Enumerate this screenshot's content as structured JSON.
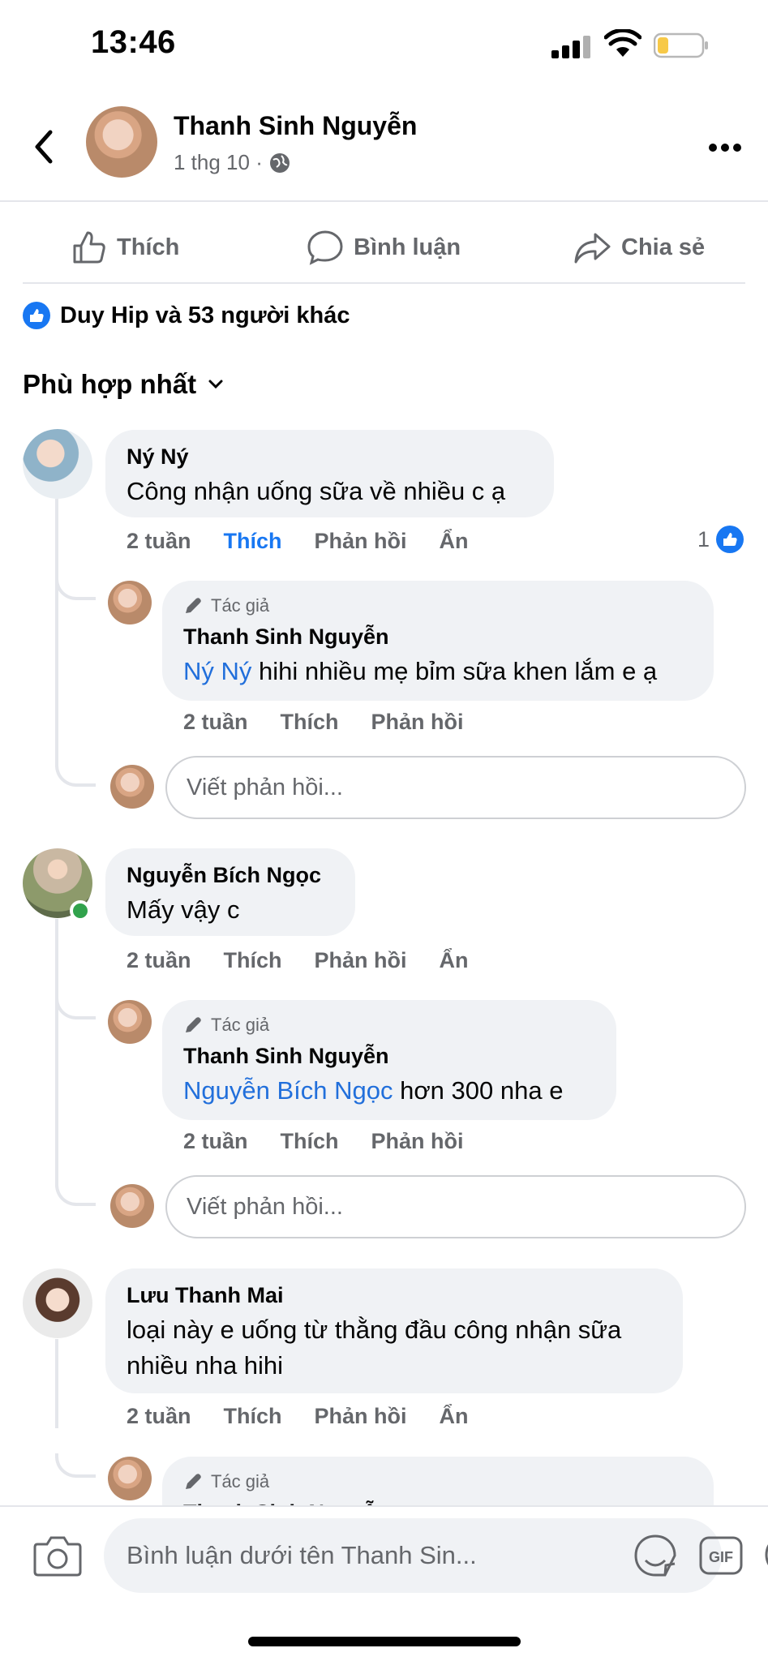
{
  "status_bar": {
    "time": "13:46",
    "battery_level": 0.25,
    "battery_color": "#f7c948"
  },
  "post": {
    "author": "Thanh Sinh Nguyễn",
    "date": "1 thg 10 ·",
    "privacy_icon": "globe-icon"
  },
  "actions": {
    "like": "Thích",
    "comment": "Bình luận",
    "share": "Chia sẻ"
  },
  "likes_summary": "Duy Hip và 53 người khác",
  "sort_label": "Phù hợp nhất",
  "author_badge": "Tác giả",
  "reply_placeholder": "Viết phản hồi...",
  "comments": [
    {
      "name": "Ný Ný",
      "text": "Công nhận uống sữa về nhiều c ạ",
      "time": "2 tuần",
      "like": "Thích",
      "reply": "Phản hồi",
      "hide": "Ẩn",
      "reactions": "1",
      "reply_item": {
        "name": "Thanh Sinh Nguyễn",
        "mention": "Ný Ný",
        "text": " hihi nhiều mẹ bỉm sữa khen lắm e ạ",
        "time": "2 tuần",
        "like": "Thích",
        "reply": "Phản hồi"
      }
    },
    {
      "name": "Nguyễn Bích Ngọc",
      "text": "Mấy vậy c",
      "time": "2 tuần",
      "like": "Thích",
      "reply": "Phản hồi",
      "hide": "Ẩn",
      "reply_item": {
        "name": "Thanh Sinh Nguyễn",
        "mention": "Nguyễn Bích Ngọc",
        "text": " hơn 300 nha e",
        "time": "2 tuần",
        "like": "Thích",
        "reply": "Phản hồi"
      }
    },
    {
      "name": "Lưu Thanh Mai",
      "text_line1": "loại này e uống từ thằng đầu công nhận sữa",
      "text_line2": "nhiều nha hihi",
      "time": "2 tuần",
      "like": "Thích",
      "reply": "Phản hồi",
      "hide": "Ẩn",
      "reply_item": {
        "name": "Thanh Sinh Nguyễn"
      }
    }
  ],
  "composer": {
    "placeholder": "Bình luận dưới tên Thanh Sin...",
    "gif_label": "GIF"
  },
  "colors": {
    "accent": "#1877f2",
    "mention": "#216fdb",
    "bubble": "#f0f2f5",
    "online": "#31a24c"
  }
}
